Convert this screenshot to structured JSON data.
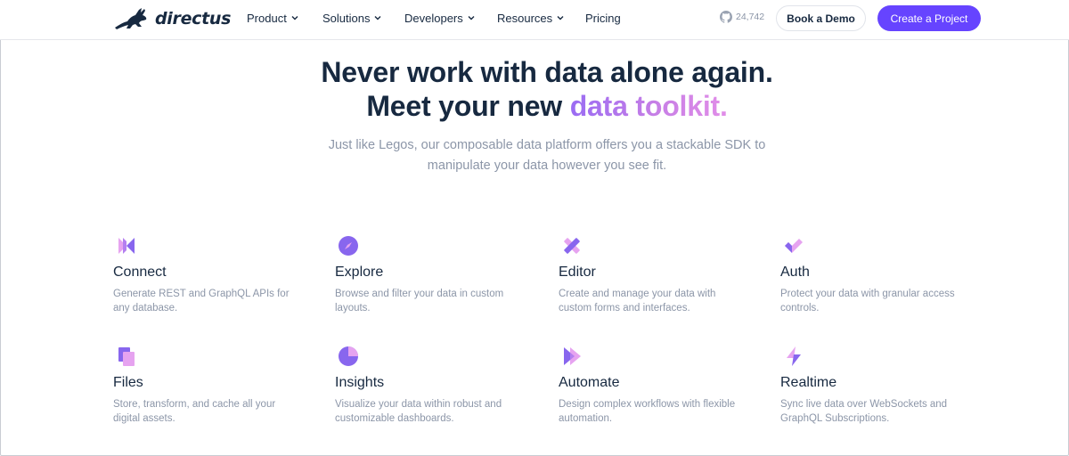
{
  "nav": {
    "brand": "directus",
    "menu": [
      {
        "label": "Product",
        "has_dropdown": true
      },
      {
        "label": "Solutions",
        "has_dropdown": true
      },
      {
        "label": "Developers",
        "has_dropdown": true
      },
      {
        "label": "Resources",
        "has_dropdown": true
      },
      {
        "label": "Pricing",
        "has_dropdown": false
      }
    ],
    "github_stars": "24,742",
    "book_demo": "Book a Demo",
    "create_project": "Create a Project"
  },
  "hero": {
    "line1": "Never work with data alone again.",
    "line2_prefix": "Meet your new",
    "line2_highlight": "data toolkit.",
    "subtitle_line1": "Just like Legos, our composable data platform offers you a stackable SDK to",
    "subtitle_line2": "manipulate your data however you see fit."
  },
  "features": [
    {
      "title": "Connect",
      "desc_line1": "Generate REST and GraphQL APIs for",
      "desc_line2": "any database.",
      "icon": "connect-icon"
    },
    {
      "title": "Explore",
      "desc_line1": "Browse and filter your data in custom",
      "desc_line2": "layouts.",
      "icon": "explore-icon"
    },
    {
      "title": "Editor",
      "desc_line1": "Create and manage your data with",
      "desc_line2": "custom forms and interfaces.",
      "icon": "editor-icon"
    },
    {
      "title": "Auth",
      "desc_line1": "Protect your data with granular access",
      "desc_line2": "controls.",
      "icon": "auth-icon"
    },
    {
      "title": "Files",
      "desc_line1": "Store, transform, and cache all your",
      "desc_line2": "digital assets.",
      "icon": "files-icon"
    },
    {
      "title": "Insights",
      "desc_line1": "Visualize your data within robust and",
      "desc_line2": "customizable dashboards.",
      "icon": "insights-icon"
    },
    {
      "title": "Automate",
      "desc_line1": "Design complex workflows with flexible",
      "desc_line2": "automation.",
      "icon": "automate-icon"
    },
    {
      "title": "Realtime",
      "desc_line1": "Sync live data over WebSockets and",
      "desc_line2": "GraphQL Subscriptions.",
      "icon": "realtime-icon"
    }
  ],
  "colors": {
    "brand_purple": "#6644ff",
    "text_dark": "#172940",
    "text_muted": "#8c96a8",
    "icon_purple": "#8866ee",
    "icon_pink": "#e6a3f0"
  }
}
